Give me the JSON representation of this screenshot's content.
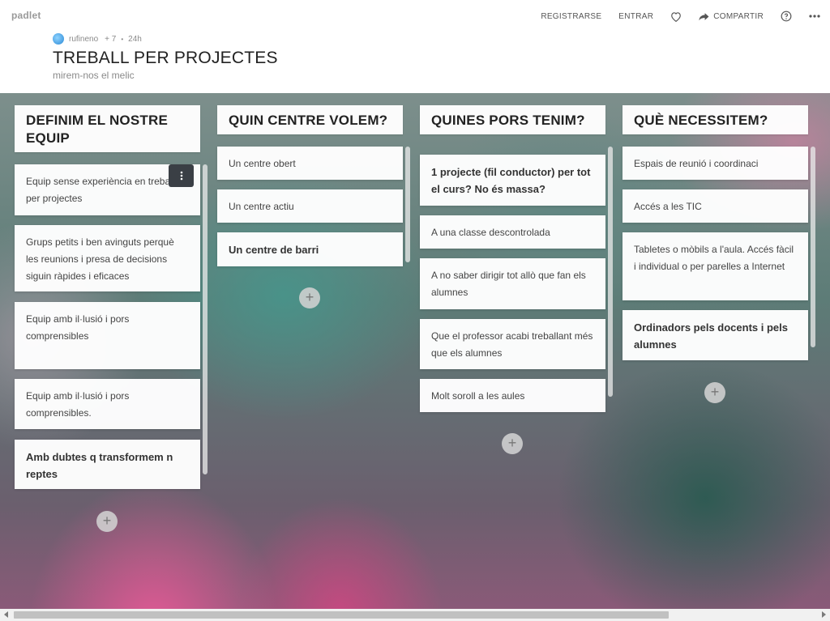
{
  "header": {
    "logo": "padlet",
    "nav": {
      "register": "REGISTRARSE",
      "login": "ENTRAR",
      "share": "COMPARTIR",
      "icons": [
        "heart-icon",
        "share-arrow-icon",
        "help-icon",
        "more-icon"
      ]
    },
    "author": "rufineno",
    "contributors": "+ 7",
    "age": "24h",
    "title": "TREBALL PER PROJECTES",
    "subtitle": "mirem-nos el melic"
  },
  "columns": [
    {
      "title": "DEFINIM EL NOSTRE EQUIP",
      "cards": [
        {
          "text": "Equip sense experiència en treball per projectes",
          "bold": false
        },
        {
          "text": "Grups petits i ben avinguts perquè les reunions i presa de decisions siguin ràpides i eficaces",
          "bold": false
        },
        {
          "text": "Equip amb il·lusió i pors comprensibles",
          "bold": false
        },
        {
          "text": "Equip amb il·lusió i pors comprensibles.",
          "bold": false
        },
        {
          "text": "Amb dubtes q transformem n reptes",
          "bold": true
        }
      ]
    },
    {
      "title": "QUIN CENTRE VOLEM?",
      "cards": [
        {
          "text": "Un centre obert",
          "bold": false
        },
        {
          "text": "Un centre actiu",
          "bold": false
        },
        {
          "text": "Un centre de barri",
          "bold": true
        }
      ]
    },
    {
      "title": "QUINES PORS TENIM?",
      "cards": [
        {
          "text": "1 projecte (fil conductor) per tot el curs? No és massa?",
          "bold": true
        },
        {
          "text": "A una classe descontrolada",
          "bold": false
        },
        {
          "text": "A no saber dirigir tot allò que fan els alumnes",
          "bold": false
        },
        {
          "text": "Que el professor acabi treballant més que els alumnes",
          "bold": false
        },
        {
          "text": "Molt soroll a les aules",
          "bold": false
        }
      ]
    },
    {
      "title": "QUÈ NECESSITEM?",
      "cards": [
        {
          "text": "Espais de reunió i coordinaci",
          "bold": false
        },
        {
          "text": "Accés a les TIC",
          "bold": false
        },
        {
          "text": "Tabletes o mòbils a l'aula. Accés fàcil i individual o per parelles a Internet",
          "bold": false
        },
        {
          "text": "Ordinadors pels docents i pels alumnes",
          "bold": true
        }
      ]
    }
  ],
  "add_label": "+"
}
